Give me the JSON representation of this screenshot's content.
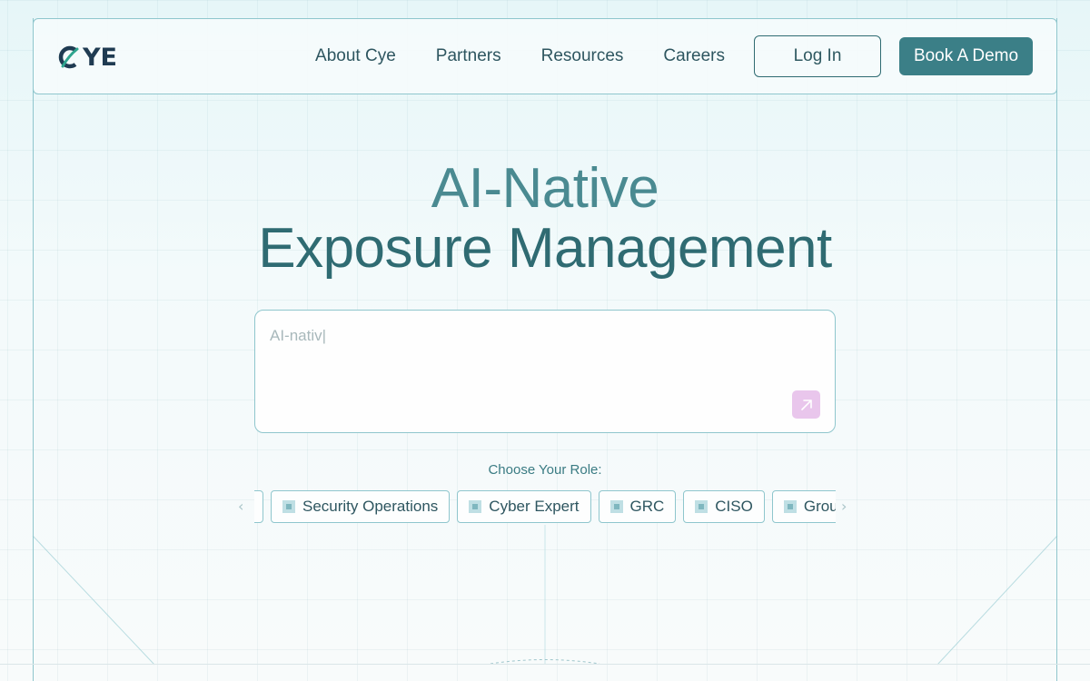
{
  "brand": {
    "logo_text": "YE"
  },
  "nav": {
    "links": [
      "About Cye",
      "Partners",
      "Resources",
      "Careers"
    ],
    "login_label": "Log In",
    "demo_label": "Book A Demo"
  },
  "hero": {
    "line1": "AI-Native",
    "line2": "Exposure Management"
  },
  "prompt": {
    "typed_text": "AI-nativ|"
  },
  "roles": {
    "label": "Choose Your Role:",
    "chips": [
      "Security Operations",
      "Cyber Expert",
      "GRC",
      "CISO",
      "Group S"
    ]
  },
  "colors": {
    "accent": "#3b7f87",
    "border": "#8fc6cd",
    "send_button": "#e9c6ec"
  },
  "icons": {
    "logo": "cye-logo-icon",
    "send": "arrow-up-right-icon",
    "prev": "chevron-left-icon",
    "next": "chevron-right-icon"
  }
}
